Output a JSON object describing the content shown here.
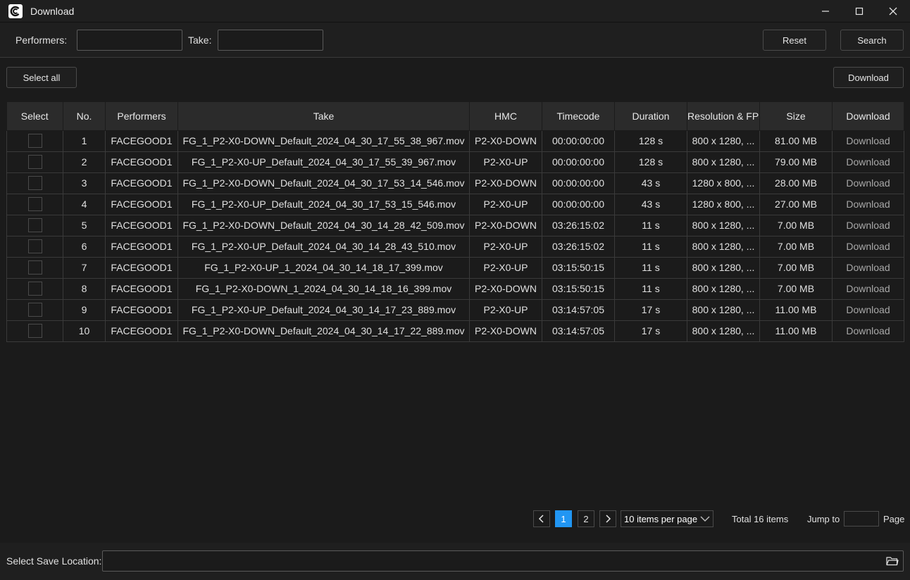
{
  "window": {
    "title": "Download"
  },
  "filters": {
    "performers_label": "Performers:",
    "performers_value": "",
    "take_label": "Take:",
    "take_value": "",
    "reset_label": "Reset",
    "search_label": "Search"
  },
  "toolbar": {
    "select_all_label": "Select all",
    "download_label": "Download"
  },
  "table": {
    "headers": {
      "select": "Select",
      "no": "No.",
      "performers": "Performers",
      "take": "Take",
      "hmc": "HMC",
      "timecode": "Timecode",
      "duration": "Duration",
      "resolution": "Resolution & FPS",
      "size": "Size",
      "download": "Download"
    },
    "rows": [
      {
        "no": "1",
        "performer": "FACEGOOD1",
        "take": "FG_1_P2-X0-DOWN_Default_2024_04_30_17_55_38_967.mov",
        "hmc": "P2-X0-DOWN",
        "timecode": "00:00:00:00",
        "duration": "128 s",
        "resolution": "800 x 1280, ...",
        "size": "81.00 MB",
        "action": "Download"
      },
      {
        "no": "2",
        "performer": "FACEGOOD1",
        "take": "FG_1_P2-X0-UP_Default_2024_04_30_17_55_39_967.mov",
        "hmc": "P2-X0-UP",
        "timecode": "00:00:00:00",
        "duration": "128 s",
        "resolution": "800 x 1280, ...",
        "size": "79.00 MB",
        "action": "Download"
      },
      {
        "no": "3",
        "performer": "FACEGOOD1",
        "take": "FG_1_P2-X0-DOWN_Default_2024_04_30_17_53_14_546.mov",
        "hmc": "P2-X0-DOWN",
        "timecode": "00:00:00:00",
        "duration": "43 s",
        "resolution": "1280 x 800, ...",
        "size": "28.00 MB",
        "action": "Download"
      },
      {
        "no": "4",
        "performer": "FACEGOOD1",
        "take": "FG_1_P2-X0-UP_Default_2024_04_30_17_53_15_546.mov",
        "hmc": "P2-X0-UP",
        "timecode": "00:00:00:00",
        "duration": "43 s",
        "resolution": "1280 x 800, ...",
        "size": "27.00 MB",
        "action": "Download"
      },
      {
        "no": "5",
        "performer": "FACEGOOD1",
        "take": "FG_1_P2-X0-DOWN_Default_2024_04_30_14_28_42_509.mov",
        "hmc": "P2-X0-DOWN",
        "timecode": "03:26:15:02",
        "duration": "11 s",
        "resolution": "800 x 1280, ...",
        "size": "7.00 MB",
        "action": "Download"
      },
      {
        "no": "6",
        "performer": "FACEGOOD1",
        "take": "FG_1_P2-X0-UP_Default_2024_04_30_14_28_43_510.mov",
        "hmc": "P2-X0-UP",
        "timecode": "03:26:15:02",
        "duration": "11 s",
        "resolution": "800 x 1280, ...",
        "size": "7.00 MB",
        "action": "Download"
      },
      {
        "no": "7",
        "performer": "FACEGOOD1",
        "take": "FG_1_P2-X0-UP_1_2024_04_30_14_18_17_399.mov",
        "hmc": "P2-X0-UP",
        "timecode": "03:15:50:15",
        "duration": "11 s",
        "resolution": "800 x 1280, ...",
        "size": "7.00 MB",
        "action": "Download"
      },
      {
        "no": "8",
        "performer": "FACEGOOD1",
        "take": "FG_1_P2-X0-DOWN_1_2024_04_30_14_18_16_399.mov",
        "hmc": "P2-X0-DOWN",
        "timecode": "03:15:50:15",
        "duration": "11 s",
        "resolution": "800 x 1280, ...",
        "size": "7.00 MB",
        "action": "Download"
      },
      {
        "no": "9",
        "performer": "FACEGOOD1",
        "take": "FG_1_P2-X0-UP_Default_2024_04_30_14_17_23_889.mov",
        "hmc": "P2-X0-UP",
        "timecode": "03:14:57:05",
        "duration": "17 s",
        "resolution": "800 x 1280, ...",
        "size": "11.00 MB",
        "action": "Download"
      },
      {
        "no": "10",
        "performer": "FACEGOOD1",
        "take": "FG_1_P2-X0-DOWN_Default_2024_04_30_14_17_22_889.mov",
        "hmc": "P2-X0-DOWN",
        "timecode": "03:14:57:05",
        "duration": "17 s",
        "resolution": "800 x 1280, ...",
        "size": "11.00 MB",
        "action": "Download"
      }
    ]
  },
  "pagination": {
    "pages": [
      "1",
      "2"
    ],
    "current_page": "1",
    "per_page": "10 items per page",
    "total": "Total 16 items",
    "jump_label": "Jump to",
    "jump_value": "",
    "page_label": "Page"
  },
  "footer": {
    "save_location_label": "Select Save Location:",
    "save_location_value": ""
  },
  "icons": {
    "app": "app-logo-icon",
    "minimize": "minimize-icon",
    "maximize": "maximize-icon",
    "close": "close-icon",
    "prev": "chevron-left-icon",
    "next": "chevron-right-icon",
    "dropdown": "chevron-down-icon",
    "folder": "folder-icon"
  },
  "colors": {
    "accent": "#2196f3",
    "background": "#1b1b1b",
    "header": "#2b2b2b"
  }
}
